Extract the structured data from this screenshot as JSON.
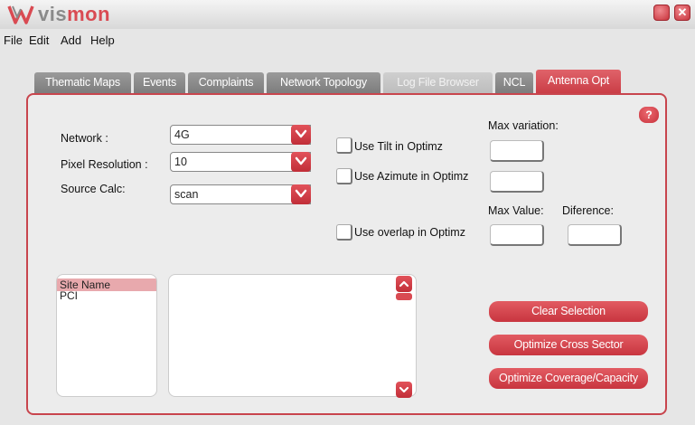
{
  "app": {
    "logo_text_1": "vis",
    "logo_text_2": "mon",
    "minimize_icon": "minimize-icon",
    "close_icon": "close-icon",
    "close_glyph": "✕"
  },
  "menu": [
    "File",
    "Edit",
    "Add",
    "Help"
  ],
  "tabs": [
    {
      "label": "Thematic Maps",
      "state": "normal"
    },
    {
      "label": "Events",
      "state": "normal"
    },
    {
      "label": "Complaints",
      "state": "normal"
    },
    {
      "label": "Network Topology",
      "state": "normal"
    },
    {
      "label": "Log File Browser",
      "state": "disabled"
    },
    {
      "label": "NCL",
      "state": "normal"
    },
    {
      "label": "Antenna Opt",
      "state": "active"
    }
  ],
  "form": {
    "network_label": "Network :",
    "network_value": "4G",
    "pixel_label": "Pixel Resolution :",
    "pixel_value": "10",
    "source_label": "Source Calc:",
    "source_value": "scan",
    "use_tilt": "Use Tilt in Optimz",
    "use_azimute": "Use Azimute in Optimz",
    "use_overlap": "Use overlap in Optimz",
    "max_variation": "Max variation:",
    "max_value": "Max Value:",
    "diference": "Diference:",
    "help": "?"
  },
  "list": {
    "items": [
      {
        "label": "Site Name",
        "selected": true
      },
      {
        "label": "PCI",
        "selected": false
      }
    ]
  },
  "buttons": {
    "clear": "Clear Selection",
    "cross_sector": "Optimize Cross Sector",
    "coverage": "Optimize Coverage/Capacity"
  },
  "colors": {
    "accent": "#d94a52",
    "tab_inactive": "#8a8a8a",
    "tab_disabled": "#c6c6c6"
  }
}
